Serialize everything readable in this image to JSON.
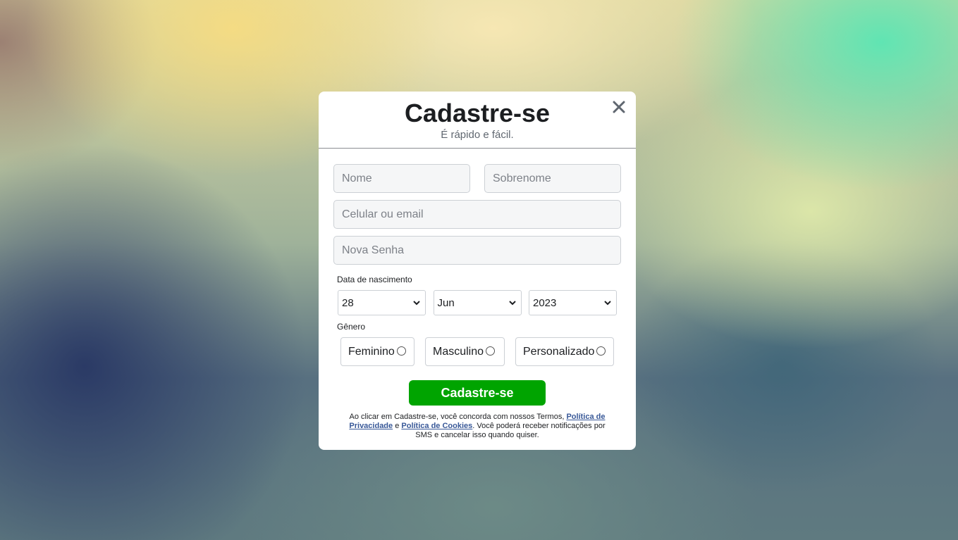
{
  "header": {
    "title": "Cadastre-se",
    "subtitle": "É rápido e fácil."
  },
  "form": {
    "first_name_placeholder": "Nome",
    "last_name_placeholder": "Sobrenome",
    "contact_placeholder": "Celular ou email",
    "password_placeholder": "Nova Senha",
    "birth_label": "Data de nascimento",
    "birth_day": "28",
    "birth_month": "Jun",
    "birth_year": "2023",
    "gender_label": "Gênero",
    "genders": [
      "Feminino",
      "Masculino",
      "Personalizado"
    ],
    "submit_label": "Cadastre-se"
  },
  "terms": {
    "text_1": "Ao clicar em Cadastre-se, você concorda com nossos Termos, ",
    "privacy_link": "Política de Privacidade",
    "text_2": " e ",
    "cookies_link": "Política de Cookies",
    "text_3": ". Você poderá receber notificações por SMS e cancelar isso quando quiser."
  },
  "colors": {
    "submit": "#00a400",
    "link": "#385898",
    "input_bg": "#f5f6f7"
  },
  "icons": {
    "close": "close-icon",
    "select": "chevron-down-icon"
  }
}
